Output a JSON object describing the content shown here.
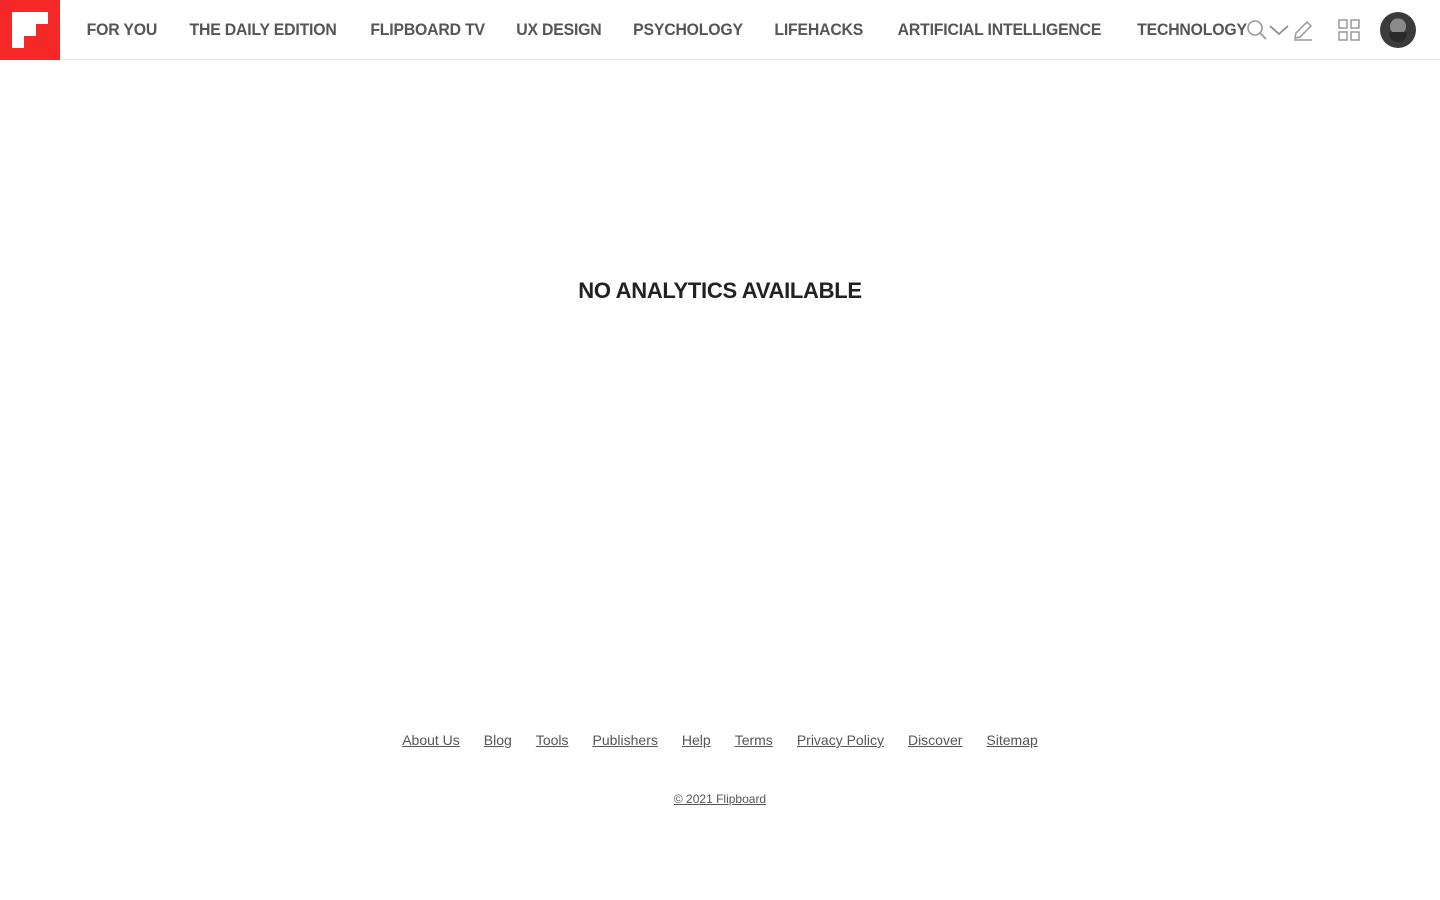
{
  "brand": {
    "color": "#f52828",
    "icon": "flipboard-logo-icon"
  },
  "nav": {
    "items": [
      {
        "label": "FOR YOU"
      },
      {
        "label": "THE DAILY EDITION"
      },
      {
        "label": "FLIPBOARD TV"
      },
      {
        "label": "UX DESIGN"
      },
      {
        "label": "PSYCHOLOGY"
      },
      {
        "label": "LIFEHACKS"
      },
      {
        "label": "ARTIFICIAL INTELLIGENCE"
      },
      {
        "label": "TECHNOLOGY"
      }
    ],
    "more_icon": "chevron-down-icon"
  },
  "tools": {
    "search_icon": "search-icon",
    "compose_icon": "pencil-icon",
    "grid_icon": "grid-icon",
    "avatar": "user-avatar"
  },
  "main": {
    "empty_message": "NO ANALYTICS AVAILABLE"
  },
  "footer": {
    "links": [
      {
        "label": "About Us"
      },
      {
        "label": "Blog"
      },
      {
        "label": "Tools"
      },
      {
        "label": "Publishers"
      },
      {
        "label": "Help"
      },
      {
        "label": "Terms"
      },
      {
        "label": "Privacy Policy"
      },
      {
        "label": "Discover"
      },
      {
        "label": "Sitemap"
      }
    ],
    "copyright": "© 2021 Flipboard"
  }
}
